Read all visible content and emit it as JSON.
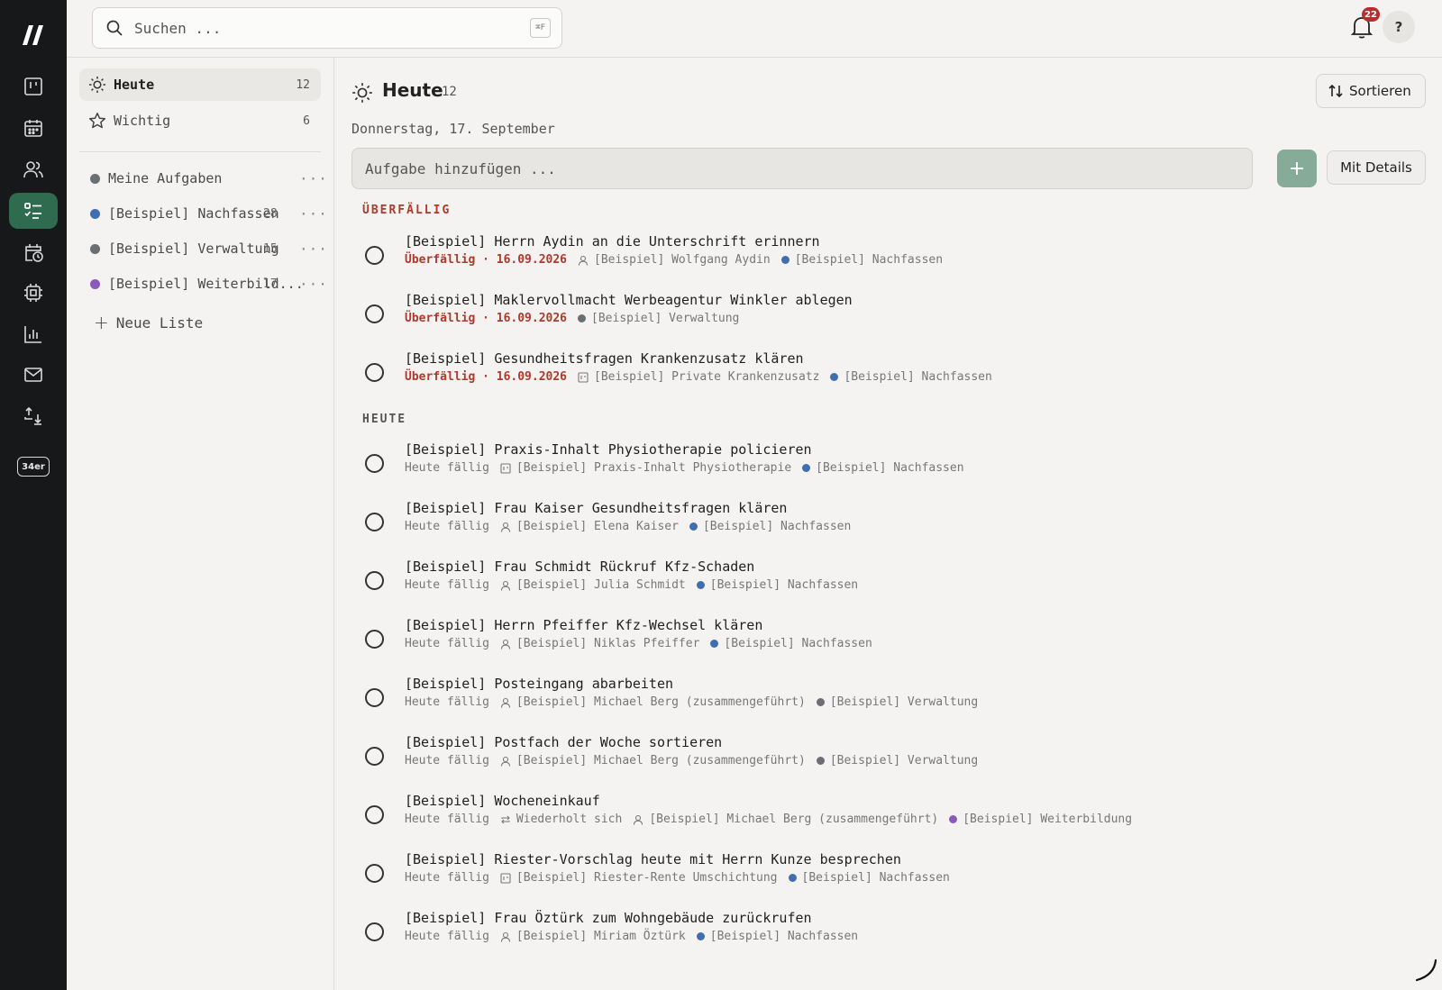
{
  "colors": {
    "rail_bg": "#161819",
    "accent_green": "#2f6b4f",
    "overdue_red": "#b0392b",
    "list_blue": "#3f6fae",
    "list_gray": "#6b6e72",
    "list_purple": "#8a5bb8"
  },
  "search": {
    "placeholder": "Suchen ...",
    "shortcut": "⌘F"
  },
  "notifications": {
    "count": "22"
  },
  "help": {
    "label": "?"
  },
  "rail": {
    "items": [
      {
        "icon": "kanban-icon"
      },
      {
        "icon": "calendar-icon"
      },
      {
        "icon": "users-icon"
      },
      {
        "icon": "tasks-icon",
        "active": true
      },
      {
        "icon": "schedule-icon"
      },
      {
        "icon": "chip-icon"
      },
      {
        "icon": "chart-icon"
      },
      {
        "icon": "mail-icon"
      },
      {
        "icon": "import-export-icon"
      }
    ],
    "badge": "34er"
  },
  "sidebar": {
    "smart_lists": [
      {
        "label": "Heute",
        "count": "12",
        "icon": "sun-icon"
      },
      {
        "label": "Wichtig",
        "count": "6",
        "icon": "star-icon"
      }
    ],
    "lists": [
      {
        "label": "Meine Aufgaben",
        "count": "",
        "color": "#6b6e72"
      },
      {
        "label": "[Beispiel] Nachfassen",
        "count": "28",
        "color": "#3f6fae"
      },
      {
        "label": "[Beispiel] Verwaltung",
        "count": "15",
        "color": "#6b6e72"
      },
      {
        "label": "[Beispiel] Weiterbild...",
        "count": "17",
        "color": "#8a5bb8"
      }
    ],
    "more_label": "···",
    "new_list": "Neue Liste"
  },
  "main": {
    "title": "Heute",
    "count": "12",
    "sort_label": "Sortieren",
    "date": "Donnerstag, 17. September",
    "add_placeholder": "Aufgabe hinzufügen ...",
    "add_button": "+",
    "details_button": "Mit Details",
    "sections": {
      "overdue": "ÜBERFÄLLIG",
      "today": "HEUTE"
    },
    "overdue_tasks": [
      {
        "title": "[Beispiel] Herrn Aydin an die Unterschrift erinnern",
        "due": "Überfällig · 16.09.2026",
        "ref_icon": "person-icon",
        "ref": "[Beispiel] Wolfgang Aydin",
        "list": "[Beispiel] Nachfassen",
        "list_color": "#3f6fae"
      },
      {
        "title": "[Beispiel] Maklervollmacht Werbeagentur Winkler ablegen",
        "due": "Überfällig · 16.09.2026",
        "list": "[Beispiel] Verwaltung",
        "list_color": "#6b6e72"
      },
      {
        "title": "[Beispiel] Gesundheitsfragen Krankenzusatz klären",
        "due": "Überfällig · 16.09.2026",
        "ref_icon": "contract-icon",
        "ref": "[Beispiel] Private Krankenzusatz",
        "list": "[Beispiel] Nachfassen",
        "list_color": "#3f6fae"
      }
    ],
    "today_tasks": [
      {
        "title": "[Beispiel] Praxis-Inhalt Physiotherapie policieren",
        "due": "Heute fällig",
        "ref_icon": "contract-icon",
        "ref": "[Beispiel] Praxis-Inhalt Physiotherapie",
        "list": "[Beispiel] Nachfassen",
        "list_color": "#3f6fae"
      },
      {
        "title": "[Beispiel] Frau Kaiser Gesundheitsfragen klären",
        "due": "Heute fällig",
        "ref_icon": "person-icon",
        "ref": "[Beispiel] Elena Kaiser",
        "list": "[Beispiel] Nachfassen",
        "list_color": "#3f6fae"
      },
      {
        "title": "[Beispiel] Frau Schmidt Rückruf Kfz-Schaden",
        "due": "Heute fällig",
        "ref_icon": "person-icon",
        "ref": "[Beispiel] Julia Schmidt",
        "list": "[Beispiel] Nachfassen",
        "list_color": "#3f6fae"
      },
      {
        "title": "[Beispiel] Herrn Pfeiffer Kfz-Wechsel klären",
        "due": "Heute fällig",
        "ref_icon": "person-icon",
        "ref": "[Beispiel] Niklas Pfeiffer",
        "list": "[Beispiel] Nachfassen",
        "list_color": "#3f6fae"
      },
      {
        "title": "[Beispiel] Posteingang abarbeiten",
        "due": "Heute fällig",
        "ref_icon": "person-icon",
        "ref": "[Beispiel] Michael Berg (zusammengeführt)",
        "list": "[Beispiel] Verwaltung",
        "list_color": "#6b6e72"
      },
      {
        "title": "[Beispiel] Postfach der Woche sortieren",
        "due": "Heute fällig",
        "ref_icon": "person-icon",
        "ref": "[Beispiel] Michael Berg (zusammengeführt)",
        "list": "[Beispiel] Verwaltung",
        "list_color": "#6b6e72"
      },
      {
        "title": "[Beispiel] Wocheneinkauf",
        "due": "Heute fällig",
        "repeat": "Wiederholt sich",
        "ref_icon": "person-icon",
        "ref": "[Beispiel] Michael Berg (zusammengeführt)",
        "list": "[Beispiel] Weiterbildung",
        "list_color": "#8a5bb8"
      },
      {
        "title": "[Beispiel] Riester-Vorschlag heute mit Herrn Kunze besprechen",
        "due": "Heute fällig",
        "ref_icon": "contract-icon",
        "ref": "[Beispiel] Riester-Rente Umschichtung",
        "list": "[Beispiel] Nachfassen",
        "list_color": "#3f6fae"
      },
      {
        "title": "[Beispiel] Frau Öztürk zum Wohngebäude zurückrufen",
        "due": "Heute fällig",
        "ref_icon": "person-icon",
        "ref": "[Beispiel] Miriam Öztürk",
        "list": "[Beispiel] Nachfassen",
        "list_color": "#3f6fae"
      }
    ]
  }
}
